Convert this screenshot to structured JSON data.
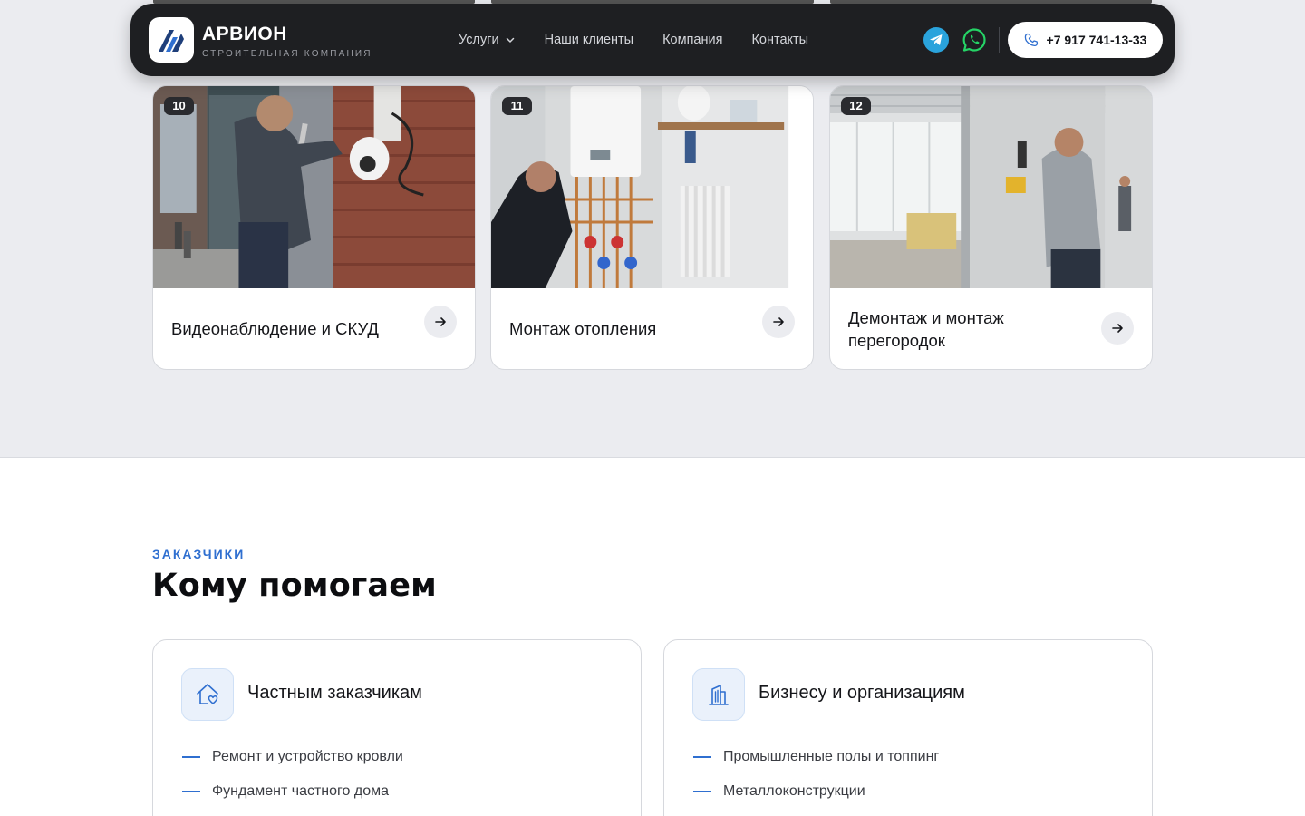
{
  "header": {
    "brand": "АРВИОН",
    "brand_sub": "СТРОИТЕЛЬНАЯ КОМПАНИЯ",
    "nav": [
      {
        "label": "Услуги",
        "has_dropdown": true
      },
      {
        "label": "Наши клиенты"
      },
      {
        "label": "Компания"
      },
      {
        "label": "Контакты"
      }
    ],
    "phone": "+7 917 741-13-33",
    "telegram_icon": "telegram-icon",
    "whatsapp_icon": "whatsapp-icon"
  },
  "services": [
    {
      "num": "10",
      "title": "Видеонаблюдение и СКУД"
    },
    {
      "num": "11",
      "title": "Монтаж отопления"
    },
    {
      "num": "12",
      "title": "Демонтаж и монтаж перегородок"
    }
  ],
  "clients": {
    "eyebrow": "ЗАКАЗЧИКИ",
    "title": "Кому помогаем",
    "cards": [
      {
        "icon": "house-heart-icon",
        "title": "Частным заказчикам",
        "items": [
          "Ремонт и устройство кровли",
          "Фундамент частного дома"
        ]
      },
      {
        "icon": "building-icon",
        "title": "Бизнесу и организациям",
        "items": [
          "Промышленные полы и топпинг",
          "Металлоконструкции"
        ]
      }
    ]
  },
  "colors": {
    "accent": "#2f6fd0",
    "header_bg": "#1e1f22",
    "section_bg": "#ebecf0",
    "telegram": "#2aa3dc",
    "whatsapp": "#25d366"
  }
}
